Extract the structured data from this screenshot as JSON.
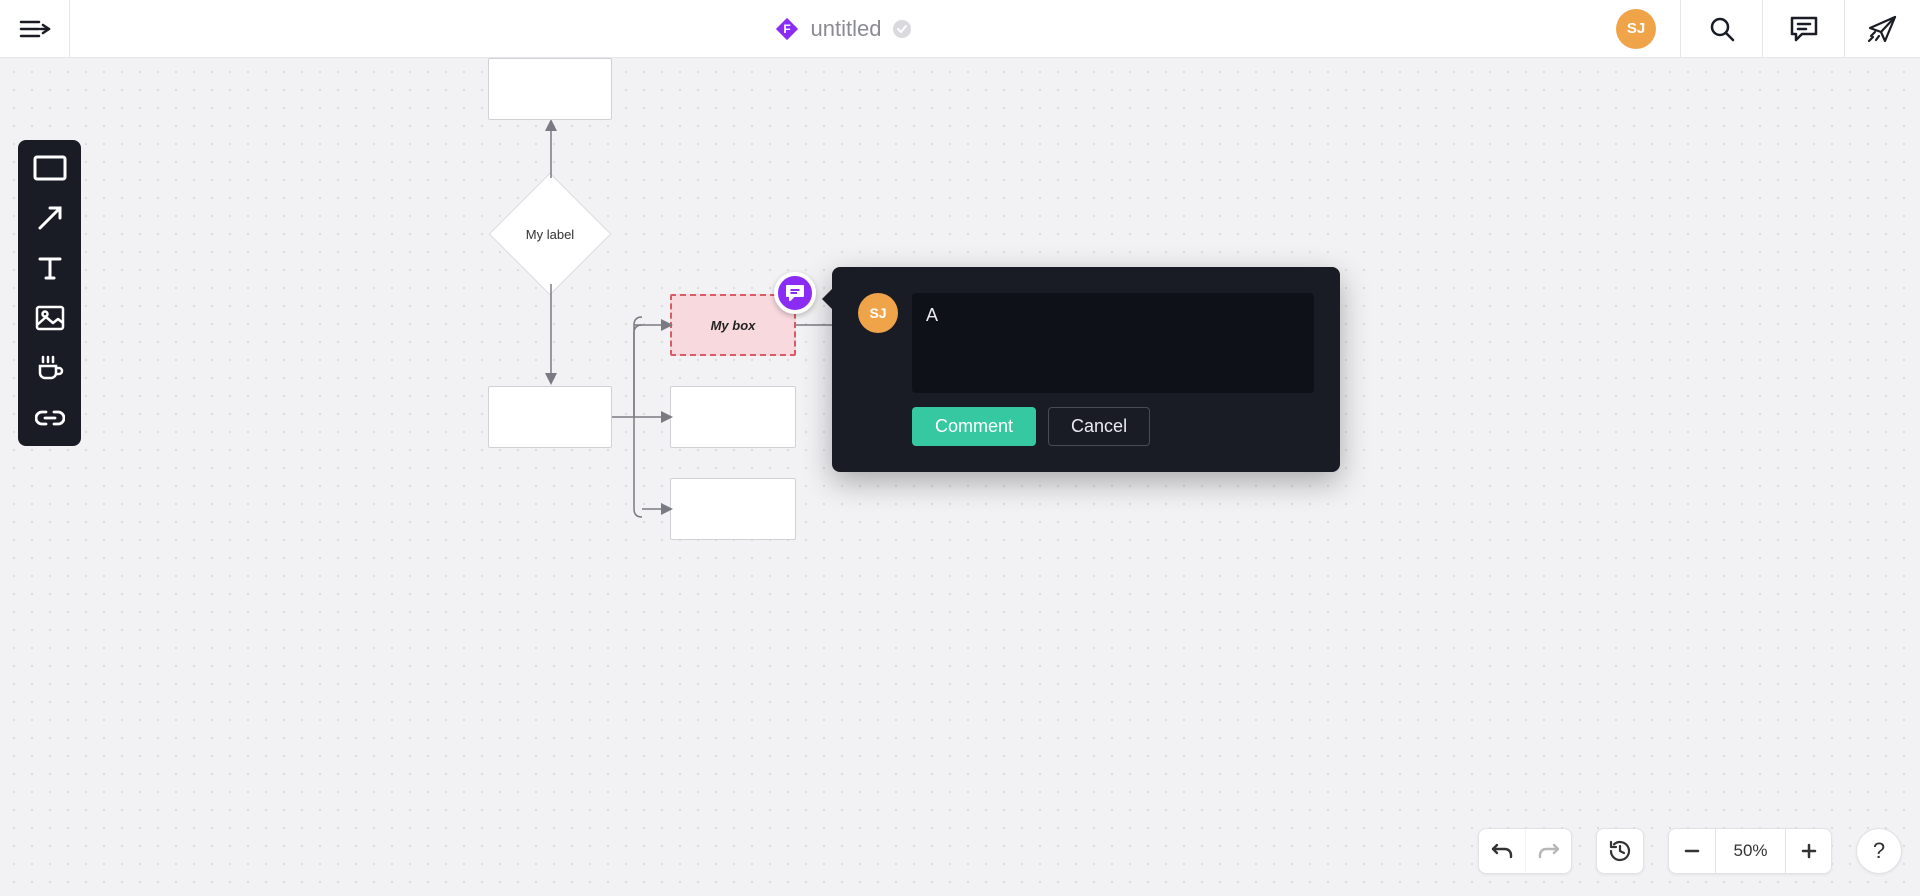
{
  "header": {
    "title": "untitled",
    "user_initials": "SJ",
    "app_logo_letter": "F"
  },
  "toolbar": {
    "tools": [
      {
        "name": "rectangle"
      },
      {
        "name": "arrow"
      },
      {
        "name": "text"
      },
      {
        "name": "image"
      },
      {
        "name": "component"
      },
      {
        "name": "link"
      }
    ]
  },
  "canvas": {
    "nodes": {
      "diamond_label": "My label",
      "selected_box_label": "My box"
    }
  },
  "comment": {
    "author_initials": "SJ",
    "draft_text": "A",
    "submit_label": "Comment",
    "cancel_label": "Cancel"
  },
  "footer": {
    "zoom_label": "50%"
  }
}
